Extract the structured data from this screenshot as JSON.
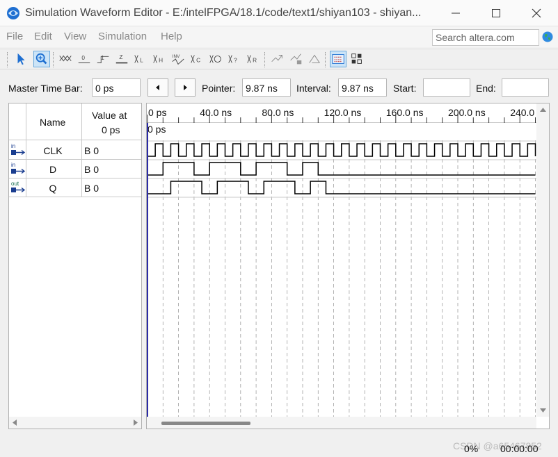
{
  "window": {
    "title": "Simulation Waveform Editor - E:/intelFPGA/18.1/code/text1/shiyan103 - shiyan..."
  },
  "menu": [
    "File",
    "Edit",
    "View",
    "Simulation",
    "Help"
  ],
  "search": {
    "placeholder": "Search altera.com"
  },
  "toolbar": {
    "tools": [
      "selection-tool-icon",
      "zoom-tool-icon",
      "forcing-unknown-icon",
      "forcing-low-icon",
      "forcing-high-icon",
      "high-impedance-icon",
      "weak-low-icon",
      "weak-high-icon",
      "invert-icon",
      "count-value-icon",
      "clock-value-icon",
      "arbitrary-value-icon",
      "random-value-icon",
      "run-functional-simulation-icon",
      "run-timing-simulation-icon",
      "generate-netlist-icon",
      "snap-to-grid-icon",
      "sort-icon"
    ]
  },
  "timebar": {
    "master_label": "Master Time Bar:",
    "master_value": "0 ps",
    "pointer_label": "Pointer:",
    "pointer_value": "9.87 ns",
    "interval_label": "Interval:",
    "interval_value": "9.87 ns",
    "start_label": "Start:",
    "start_value": "",
    "end_label": "End:",
    "end_value": ""
  },
  "table": {
    "name_header": "Name",
    "value_header_1": "Value at",
    "value_header_2": "0 ps",
    "signals": [
      {
        "dir": "in",
        "name": "CLK",
        "value": "B 0"
      },
      {
        "dir": "in",
        "name": "D",
        "value": "B 0"
      },
      {
        "dir": "out",
        "name": "Q",
        "value": "B 0"
      }
    ]
  },
  "ruler": {
    "labels": [
      "0 ps",
      "40.0 ns",
      "80.0 ns",
      "120.0 ns",
      "160.0 ns",
      "200.0 ns",
      "240.0 ns"
    ],
    "cursor_label": "0 ps"
  },
  "waveforms": {
    "clk_period_ns": 10,
    "d_transitions_ns": [
      0,
      10,
      30,
      40,
      60,
      70,
      90,
      100,
      110,
      250
    ],
    "q_transitions_ns": [
      0,
      15,
      35,
      45,
      65,
      75,
      95,
      105,
      115,
      250
    ]
  },
  "status": {
    "progress": "0%",
    "elapsed": "00:00:00",
    "watermark": "CSDN @a65467852"
  },
  "colors": {
    "accent": "#1f6fd1",
    "cursor": "#2a2aa8",
    "wave": "#000000",
    "grid": "#a0a0a0"
  }
}
